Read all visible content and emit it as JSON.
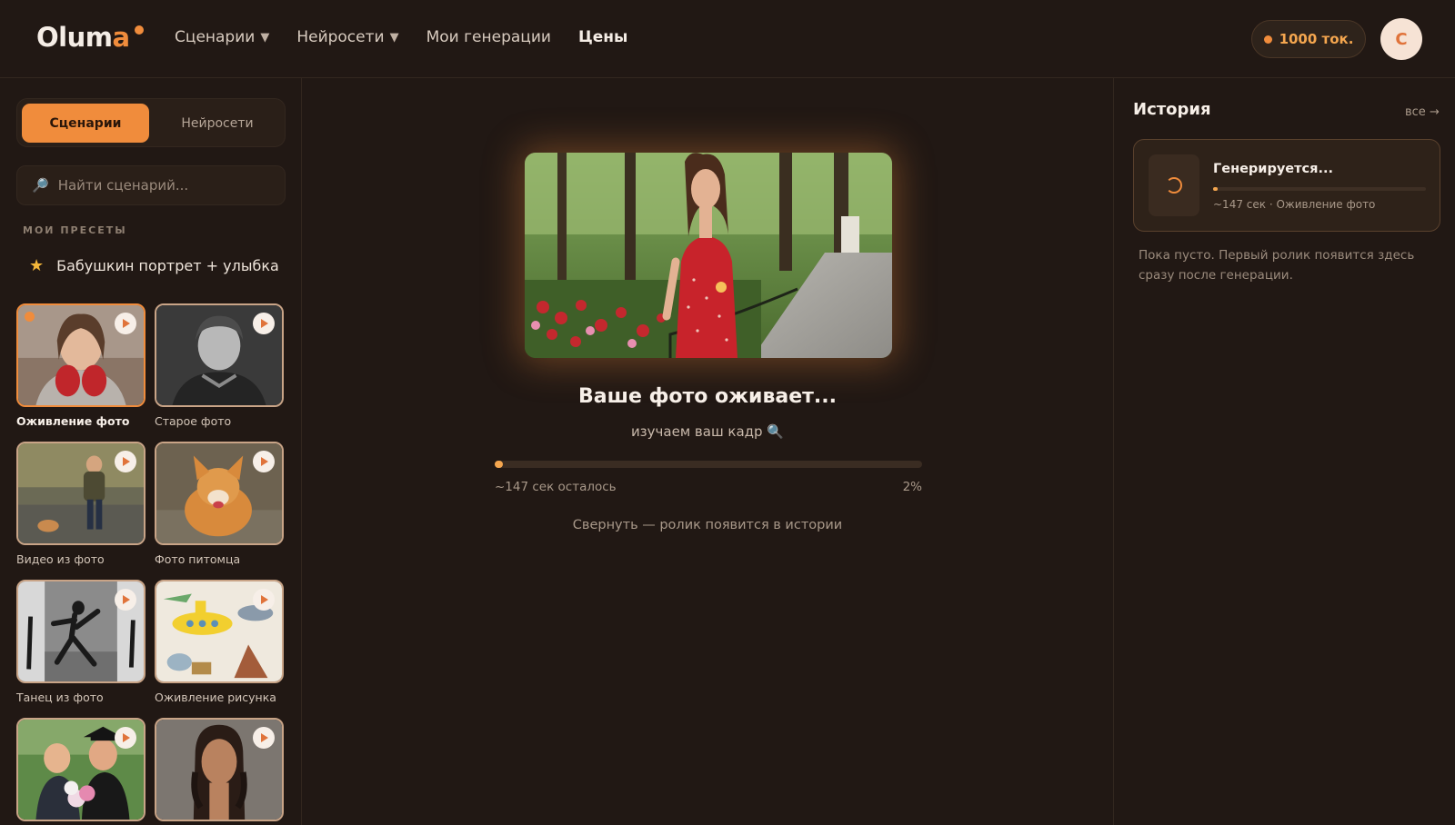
{
  "header": {
    "logo_main": "Olum",
    "logo_accent": "a",
    "nav": [
      {
        "label": "Сценарии",
        "caret": "▼"
      },
      {
        "label": "Нейросети",
        "caret": "▼"
      },
      {
        "label": "Мои генерации"
      },
      {
        "label": "Цены"
      }
    ],
    "tokens": "1000 ток.",
    "avatar_letter": "С"
  },
  "sidebar": {
    "tabs": [
      {
        "label": "Сценарии",
        "active": true
      },
      {
        "label": "Нейросети",
        "active": false
      }
    ],
    "search_placeholder": "Найти сценарий...",
    "presets_label": "МОИ ПРЕСЕТЫ",
    "presets": [
      {
        "icon": "star-icon",
        "label": "Бабушкин портрет + улыбка"
      }
    ],
    "cards": [
      {
        "label": "Оживление фото",
        "selected": true
      },
      {
        "label": "Старое фото",
        "selected": false
      },
      {
        "label": "Видео из фото",
        "selected": false
      },
      {
        "label": "Фото питомца",
        "selected": false
      },
      {
        "label": "Танец из фото",
        "selected": false
      },
      {
        "label": "Оживление рисунка",
        "selected": false
      },
      {
        "label": "",
        "selected": false
      },
      {
        "label": "",
        "selected": false
      }
    ]
  },
  "generation": {
    "title": "Ваше фото оживает...",
    "subtitle": "изучаем ваш кадр",
    "subtitle_icon": "🔍",
    "progress": 2,
    "eta": "~147 сек осталось",
    "percent_label": "2%",
    "collapse_hint": "Свернуть — ролик появится в истории"
  },
  "history": {
    "title": "История",
    "all_link": "все →",
    "item": {
      "status": "Генерируется...",
      "meta": "~147 сек · Оживление фото",
      "progress": 2
    },
    "empty_note": "Пока пусто. Первый ролик появится здесь сразу после генерации."
  },
  "colors": {
    "background": "#211814",
    "accent": "#f08c3c",
    "accent_light": "#f4a64f"
  }
}
